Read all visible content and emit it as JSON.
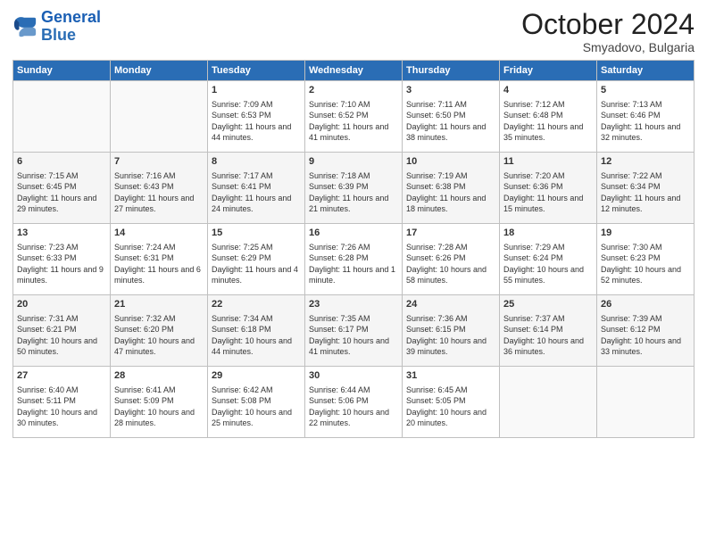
{
  "header": {
    "logo_general": "General",
    "logo_blue": "Blue",
    "month": "October 2024",
    "location": "Smyadovo, Bulgaria"
  },
  "weekdays": [
    "Sunday",
    "Monday",
    "Tuesday",
    "Wednesday",
    "Thursday",
    "Friday",
    "Saturday"
  ],
  "weeks": [
    [
      {
        "day": "",
        "sunrise": "",
        "sunset": "",
        "daylight": ""
      },
      {
        "day": "",
        "sunrise": "",
        "sunset": "",
        "daylight": ""
      },
      {
        "day": "1",
        "sunrise": "Sunrise: 7:09 AM",
        "sunset": "Sunset: 6:53 PM",
        "daylight": "Daylight: 11 hours and 44 minutes."
      },
      {
        "day": "2",
        "sunrise": "Sunrise: 7:10 AM",
        "sunset": "Sunset: 6:52 PM",
        "daylight": "Daylight: 11 hours and 41 minutes."
      },
      {
        "day": "3",
        "sunrise": "Sunrise: 7:11 AM",
        "sunset": "Sunset: 6:50 PM",
        "daylight": "Daylight: 11 hours and 38 minutes."
      },
      {
        "day": "4",
        "sunrise": "Sunrise: 7:12 AM",
        "sunset": "Sunset: 6:48 PM",
        "daylight": "Daylight: 11 hours and 35 minutes."
      },
      {
        "day": "5",
        "sunrise": "Sunrise: 7:13 AM",
        "sunset": "Sunset: 6:46 PM",
        "daylight": "Daylight: 11 hours and 32 minutes."
      }
    ],
    [
      {
        "day": "6",
        "sunrise": "Sunrise: 7:15 AM",
        "sunset": "Sunset: 6:45 PM",
        "daylight": "Daylight: 11 hours and 29 minutes."
      },
      {
        "day": "7",
        "sunrise": "Sunrise: 7:16 AM",
        "sunset": "Sunset: 6:43 PM",
        "daylight": "Daylight: 11 hours and 27 minutes."
      },
      {
        "day": "8",
        "sunrise": "Sunrise: 7:17 AM",
        "sunset": "Sunset: 6:41 PM",
        "daylight": "Daylight: 11 hours and 24 minutes."
      },
      {
        "day": "9",
        "sunrise": "Sunrise: 7:18 AM",
        "sunset": "Sunset: 6:39 PM",
        "daylight": "Daylight: 11 hours and 21 minutes."
      },
      {
        "day": "10",
        "sunrise": "Sunrise: 7:19 AM",
        "sunset": "Sunset: 6:38 PM",
        "daylight": "Daylight: 11 hours and 18 minutes."
      },
      {
        "day": "11",
        "sunrise": "Sunrise: 7:20 AM",
        "sunset": "Sunset: 6:36 PM",
        "daylight": "Daylight: 11 hours and 15 minutes."
      },
      {
        "day": "12",
        "sunrise": "Sunrise: 7:22 AM",
        "sunset": "Sunset: 6:34 PM",
        "daylight": "Daylight: 11 hours and 12 minutes."
      }
    ],
    [
      {
        "day": "13",
        "sunrise": "Sunrise: 7:23 AM",
        "sunset": "Sunset: 6:33 PM",
        "daylight": "Daylight: 11 hours and 9 minutes."
      },
      {
        "day": "14",
        "sunrise": "Sunrise: 7:24 AM",
        "sunset": "Sunset: 6:31 PM",
        "daylight": "Daylight: 11 hours and 6 minutes."
      },
      {
        "day": "15",
        "sunrise": "Sunrise: 7:25 AM",
        "sunset": "Sunset: 6:29 PM",
        "daylight": "Daylight: 11 hours and 4 minutes."
      },
      {
        "day": "16",
        "sunrise": "Sunrise: 7:26 AM",
        "sunset": "Sunset: 6:28 PM",
        "daylight": "Daylight: 11 hours and 1 minute."
      },
      {
        "day": "17",
        "sunrise": "Sunrise: 7:28 AM",
        "sunset": "Sunset: 6:26 PM",
        "daylight": "Daylight: 10 hours and 58 minutes."
      },
      {
        "day": "18",
        "sunrise": "Sunrise: 7:29 AM",
        "sunset": "Sunset: 6:24 PM",
        "daylight": "Daylight: 10 hours and 55 minutes."
      },
      {
        "day": "19",
        "sunrise": "Sunrise: 7:30 AM",
        "sunset": "Sunset: 6:23 PM",
        "daylight": "Daylight: 10 hours and 52 minutes."
      }
    ],
    [
      {
        "day": "20",
        "sunrise": "Sunrise: 7:31 AM",
        "sunset": "Sunset: 6:21 PM",
        "daylight": "Daylight: 10 hours and 50 minutes."
      },
      {
        "day": "21",
        "sunrise": "Sunrise: 7:32 AM",
        "sunset": "Sunset: 6:20 PM",
        "daylight": "Daylight: 10 hours and 47 minutes."
      },
      {
        "day": "22",
        "sunrise": "Sunrise: 7:34 AM",
        "sunset": "Sunset: 6:18 PM",
        "daylight": "Daylight: 10 hours and 44 minutes."
      },
      {
        "day": "23",
        "sunrise": "Sunrise: 7:35 AM",
        "sunset": "Sunset: 6:17 PM",
        "daylight": "Daylight: 10 hours and 41 minutes."
      },
      {
        "day": "24",
        "sunrise": "Sunrise: 7:36 AM",
        "sunset": "Sunset: 6:15 PM",
        "daylight": "Daylight: 10 hours and 39 minutes."
      },
      {
        "day": "25",
        "sunrise": "Sunrise: 7:37 AM",
        "sunset": "Sunset: 6:14 PM",
        "daylight": "Daylight: 10 hours and 36 minutes."
      },
      {
        "day": "26",
        "sunrise": "Sunrise: 7:39 AM",
        "sunset": "Sunset: 6:12 PM",
        "daylight": "Daylight: 10 hours and 33 minutes."
      }
    ],
    [
      {
        "day": "27",
        "sunrise": "Sunrise: 6:40 AM",
        "sunset": "Sunset: 5:11 PM",
        "daylight": "Daylight: 10 hours and 30 minutes."
      },
      {
        "day": "28",
        "sunrise": "Sunrise: 6:41 AM",
        "sunset": "Sunset: 5:09 PM",
        "daylight": "Daylight: 10 hours and 28 minutes."
      },
      {
        "day": "29",
        "sunrise": "Sunrise: 6:42 AM",
        "sunset": "Sunset: 5:08 PM",
        "daylight": "Daylight: 10 hours and 25 minutes."
      },
      {
        "day": "30",
        "sunrise": "Sunrise: 6:44 AM",
        "sunset": "Sunset: 5:06 PM",
        "daylight": "Daylight: 10 hours and 22 minutes."
      },
      {
        "day": "31",
        "sunrise": "Sunrise: 6:45 AM",
        "sunset": "Sunset: 5:05 PM",
        "daylight": "Daylight: 10 hours and 20 minutes."
      },
      {
        "day": "",
        "sunrise": "",
        "sunset": "",
        "daylight": ""
      },
      {
        "day": "",
        "sunrise": "",
        "sunset": "",
        "daylight": ""
      }
    ]
  ]
}
